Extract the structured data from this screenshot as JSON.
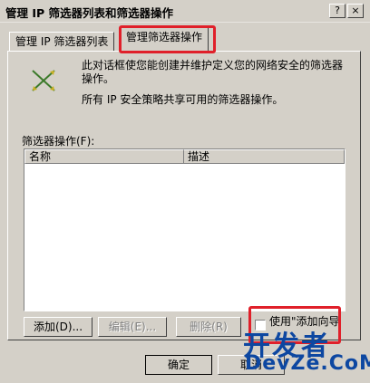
{
  "window": {
    "title": "管理 IP 筛选器列表和筛选器操作",
    "help_glyph": "?",
    "close_glyph": "×"
  },
  "tabs": [
    {
      "label": "管理 IP 筛选器列表"
    },
    {
      "label": "管理筛选器操作",
      "selected": true
    }
  ],
  "panel": {
    "icon": "filter-action-icon",
    "description": "此对话框使您能创建并维护定义您的网络安全的筛选器操作。",
    "shared_note": "所有 IP 安全策略共享可用的筛选器操作。",
    "list_label": "筛选器操作(F):",
    "columns": [
      "名称",
      "描述"
    ],
    "rows": []
  },
  "buttons": {
    "add": "添加(D)...",
    "edit": "编辑(E)...",
    "delete": "删除(R)",
    "wizard_checkbox": "使用\"添加向导\"",
    "ok": "确定",
    "cancel": "取消"
  },
  "watermark": {
    "line1": "开发者",
    "line2": "DevZe.CoM"
  },
  "colors": {
    "highlight": "#e0202a",
    "dialog_bg": "#d4d0c8",
    "watermark": "#0d47a1"
  }
}
